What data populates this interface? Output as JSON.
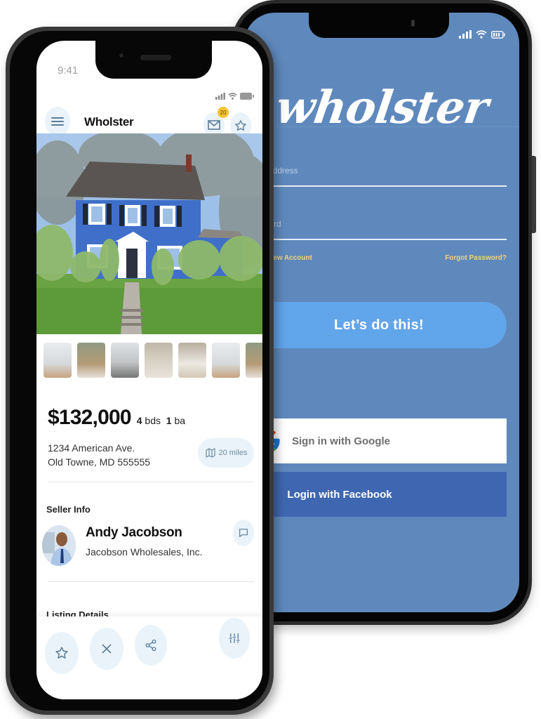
{
  "login_screen": {
    "logo": "wholster",
    "email_placeholder": "Email Address",
    "password_placeholder": "Password",
    "create_account": "Create New Account",
    "forgot_password": "Forgot Password?",
    "cta_label": "Let’s do this!",
    "google_label": "Sign in with Google",
    "facebook_label": "Login with Facebook",
    "colors": {
      "background": "#5f89bd",
      "cta": "#61a5ea",
      "link": "#f2d27a",
      "facebook": "#3f67b1"
    }
  },
  "listing_screen": {
    "status_time": "9:41",
    "app_title": "Wholster",
    "mail_badge_count": "20",
    "icons": {
      "menu": "hamburger-icon",
      "mail": "mail-icon",
      "favorite": "star-icon",
      "map": "map-icon",
      "chat": "chat-bubble-icon",
      "close": "close-icon",
      "share": "share-icon",
      "filters": "sliders-icon"
    },
    "price": "$132,000",
    "beds_count": "4",
    "beds_label": "bds",
    "baths_count": "1",
    "baths_label": "ba",
    "address_line1": "1234 American Ave.",
    "address_line2": "Old Towne, MD 555555",
    "distance": "20 miles",
    "seller_section": "Seller Info",
    "seller_name": "Andy Jacobson",
    "seller_company": "Jacobson Wholesales, Inc.",
    "listing_section": "Listing Details",
    "thumbnails": [
      "interior-1",
      "interior-2",
      "interior-3",
      "interior-4",
      "interior-5",
      "interior-6",
      "interior-7"
    ]
  }
}
